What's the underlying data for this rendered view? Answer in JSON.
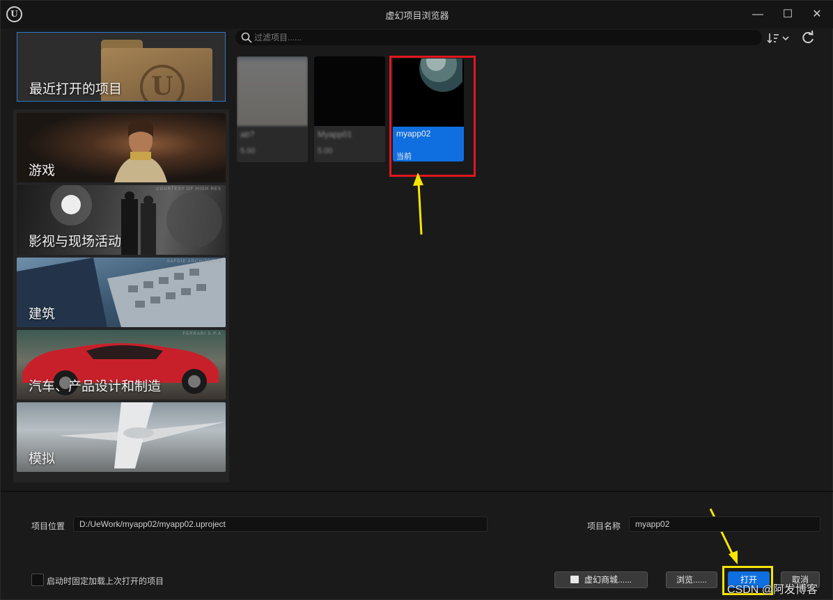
{
  "window": {
    "title": "虚幻项目浏览器",
    "controls": {
      "minimize": "—",
      "maximize": "☐",
      "close": "✕"
    },
    "logo": "U"
  },
  "sidebar": {
    "recent": {
      "label": "最近打开的项目",
      "icon": "folder-icon"
    },
    "categories": [
      {
        "label": "游戏",
        "credit": ""
      },
      {
        "label": "影视与现场活动",
        "credit": "COURTESY OF HIGH RES"
      },
      {
        "label": "建筑",
        "credit": "SAFDIE ARCHITECTS"
      },
      {
        "label": "汽车、产品设计和制造",
        "credit": "FERRARI S.P.A"
      },
      {
        "label": "模拟",
        "credit": ""
      }
    ]
  },
  "search": {
    "placeholder": "过滤项目......",
    "value": ""
  },
  "projects": [
    {
      "name": "ab?",
      "sub": "5.00",
      "blurred": true
    },
    {
      "name": "Myapp01",
      "sub": "5.00",
      "blurred": true
    },
    {
      "name": "myapp02",
      "sub": "当前",
      "selected": true
    }
  ],
  "bottom": {
    "location_label": "项目位置",
    "location_value": "D:/UeWork/myapp02/myapp02.uproject",
    "name_label": "项目名称",
    "name_value": "myapp02",
    "autoload_label": "启动时固定加载上次打开的项目",
    "marketplace_button": "虚幻商城......",
    "browse_button": "浏览......",
    "open_button": "打开",
    "cancel_button": "取消"
  },
  "watermark": "CSDN @阿发博客",
  "colors": {
    "accent": "#0f6fe0",
    "annotation_red": "#e3161e",
    "annotation_yellow": "#f7e600"
  }
}
